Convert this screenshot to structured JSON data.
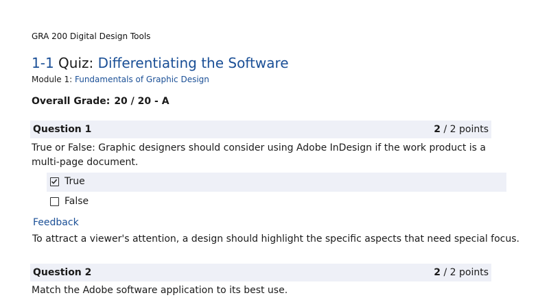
{
  "course": "GRA 200 Digital Design Tools",
  "quiz": {
    "prefix": "1-1",
    "quiz_word": "Quiz:",
    "name": "Differentiating the Software"
  },
  "module": {
    "label": "Module 1:",
    "link": "Fundamentals of Graphic Design"
  },
  "grade": {
    "label": "Overall Grade:",
    "value": "20 / 20 - A"
  },
  "questions": [
    {
      "label": "Question 1",
      "score": "2",
      "points": "/ 2 points",
      "text": "True or False: Graphic designers should consider using Adobe InDesign if the work product is a multi-page document.",
      "options": [
        {
          "label": "True",
          "checked": true
        },
        {
          "label": "False",
          "checked": false
        }
      ],
      "feedback_heading": "Feedback",
      "feedback": "To attract a viewer's attention, a design should highlight the specific aspects that need special focus."
    },
    {
      "label": "Question 2",
      "score": "2",
      "points": "/ 2 points",
      "text": "Match the Adobe software application to its best use."
    }
  ],
  "icons": {
    "checked_box": "checkbox-checked-icon",
    "unchecked_box": "checkbox-unchecked-icon"
  },
  "colors": {
    "accent": "#1a4f96",
    "question_bar": "#eef0f7"
  }
}
